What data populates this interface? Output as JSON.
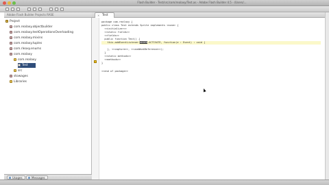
{
  "window": {
    "title": "Flash Builder - Test/src/com/realaxy/Test.as - Adobe Flash Builder 4.5 - /Users/...",
    "subtitle": "Flash Builder Package Explorer"
  },
  "package_explorer": {
    "header": "Adobe Flash Builder Projects RASE",
    "items": [
      {
        "label": "Project",
        "icon": "project-icon",
        "indent": 0
      },
      {
        "label": "com.realaxy.objectbuilder",
        "icon": "package-icon",
        "indent": 1
      },
      {
        "label": "com.realaxy.testOperationsOverloading",
        "icon": "package-icon",
        "indent": 1
      },
      {
        "label": "com.realaxy.mixins",
        "icon": "package-icon",
        "indent": 1
      },
      {
        "label": "com.realaxy.tuples",
        "icon": "package-icon",
        "indent": 1
      },
      {
        "label": "com.rleaxy.enums",
        "icon": "package-icon",
        "indent": 1
      },
      {
        "label": "com.realaxy",
        "icon": "package-icon",
        "indent": 1
      },
      {
        "label": "com.realaxy",
        "icon": "folder-icon",
        "indent": 2
      },
      {
        "label": "Test",
        "icon": "file-icon",
        "indent": 3,
        "selected": true
      },
      {
        "label": "src",
        "icon": "folder-icon",
        "indent": 2
      },
      {
        "label": "stowages",
        "icon": "package-icon",
        "indent": 1
      },
      {
        "label": "Libraries",
        "icon": "folder-icon",
        "indent": 1
      }
    ],
    "bottom_tabs": [
      {
        "label": "Usages"
      },
      {
        "label": "Messages"
      }
    ]
  },
  "editor": {
    "tab_label": "Test",
    "lines": [
      {
        "text": "package com.realaxy {"
      },
      {
        "text": "public class Test extends Sprite implements <none> {"
      },
      {
        "text": "  <<initializer>>"
      },
      {
        "text": "  <<static fields>>"
      },
      {
        "text": "  <<fields>>"
      },
      {
        "text": "  public function Test() {"
      },
      {
        "text": "    this.addEventListener(",
        "selected": "ADDED",
        "after": ".ACTIVATE, function(e : Event) : void {",
        "highlight": true
      },
      {
        "text": ""
      },
      {
        "text": "    }, <<capture>>, <<useWeakReference>>);"
      },
      {
        "text": "  }"
      },
      {
        "text": "  <<static methods>>"
      },
      {
        "text": "  <<methods>>"
      },
      {
        "text": "}"
      },
      {
        "text": ""
      },
      {
        "text": "<<end of package>>"
      }
    ]
  },
  "status_bar": {
    "text": ""
  }
}
